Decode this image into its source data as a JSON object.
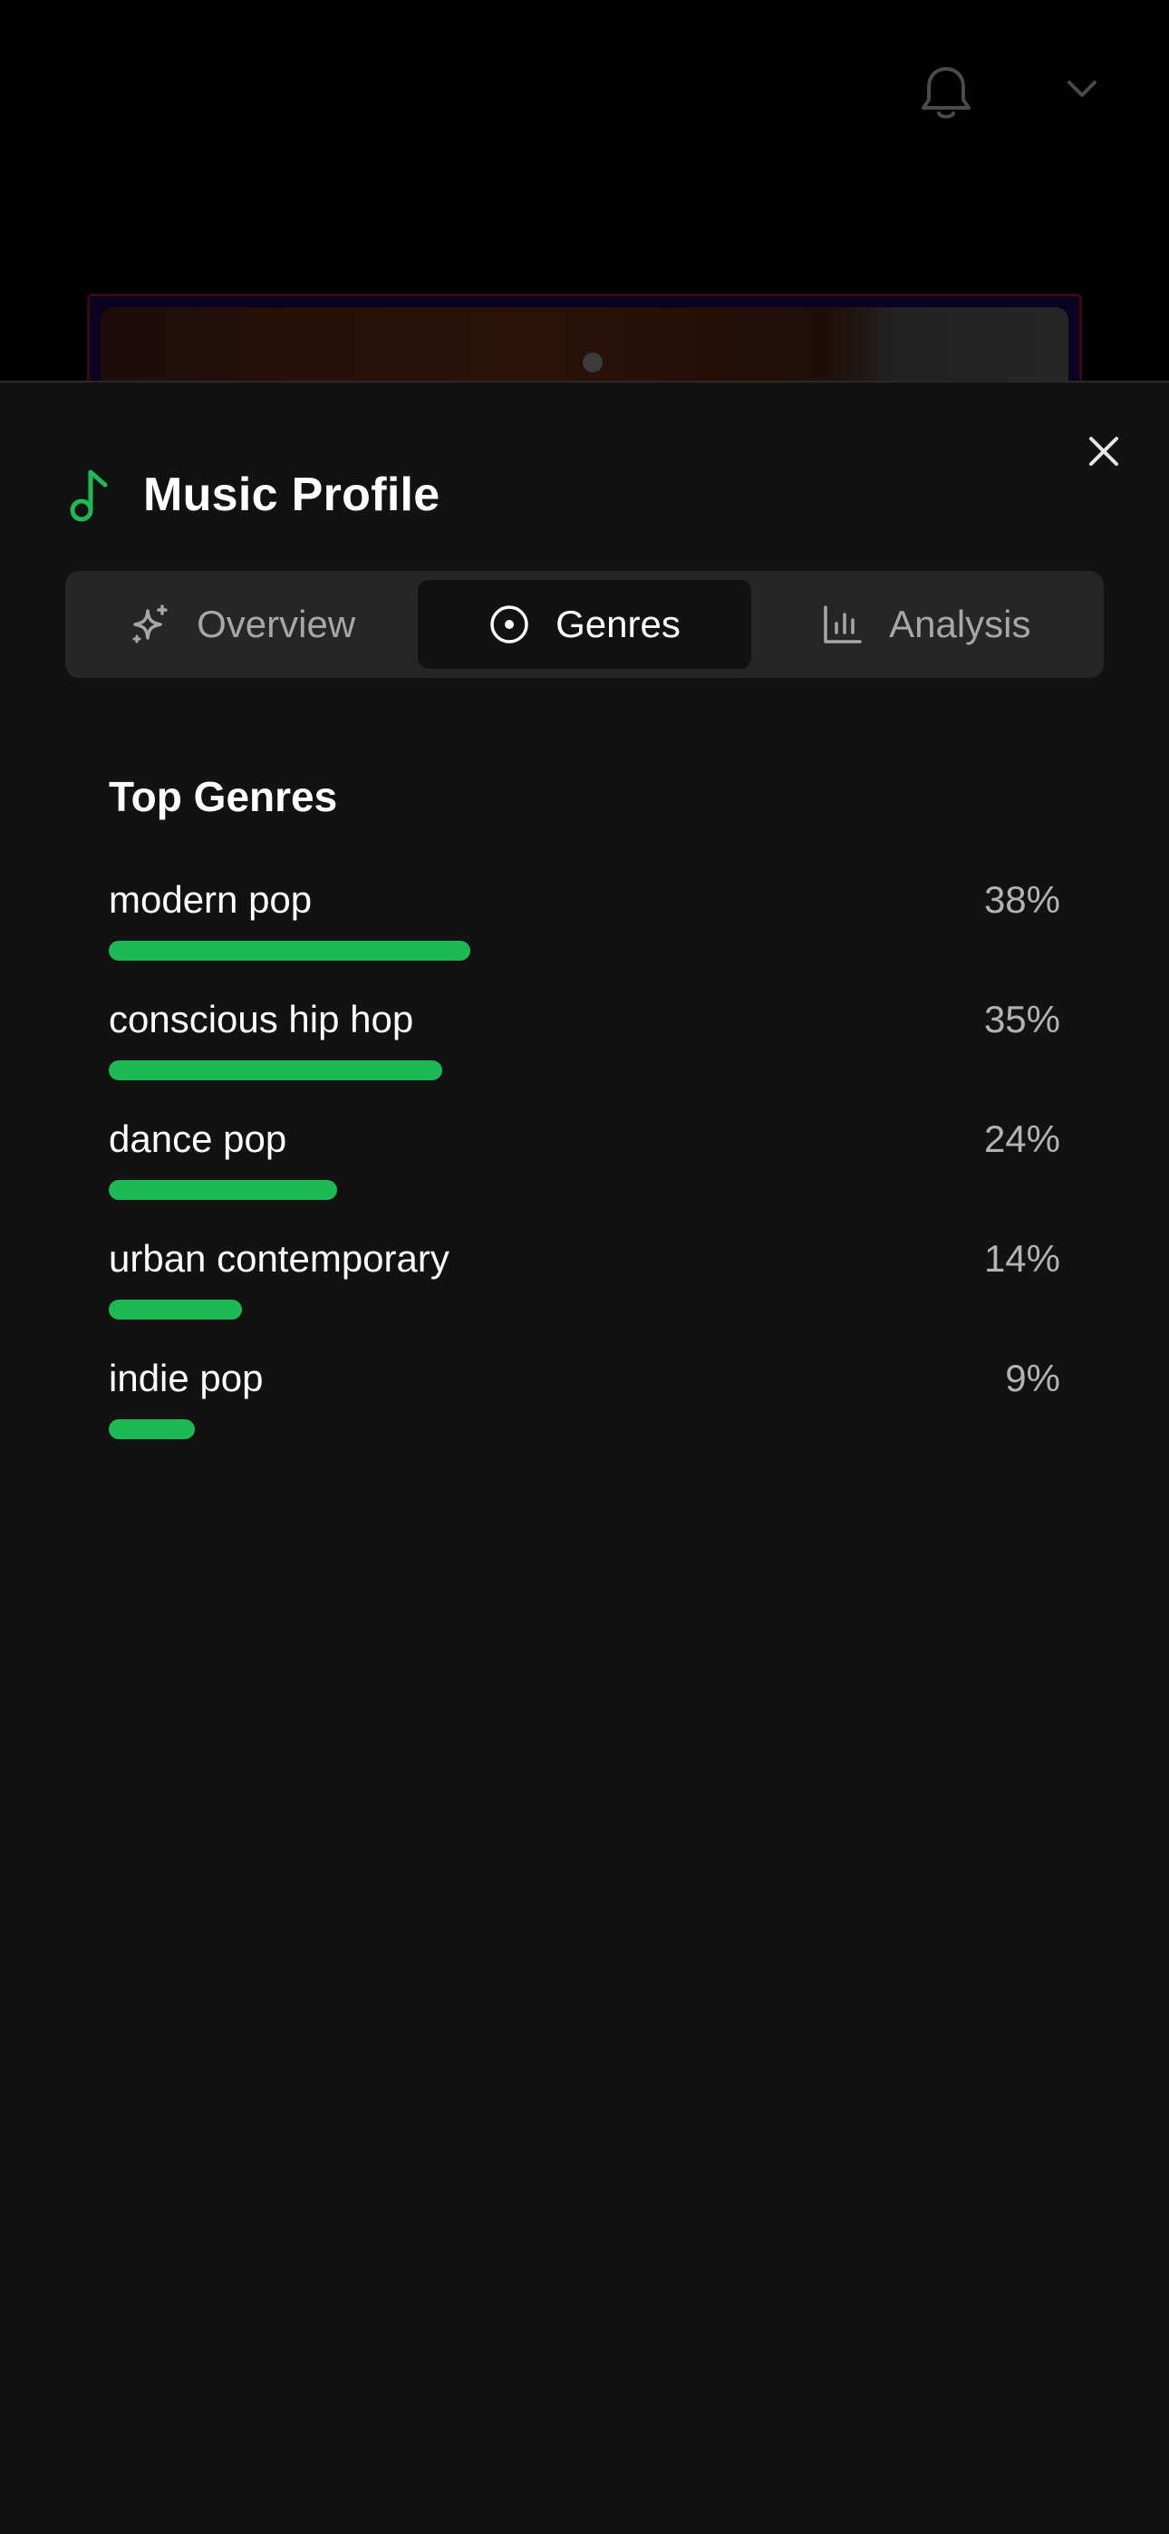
{
  "sheet": {
    "title": "Music Profile",
    "icons": {
      "header": "music-note-icon",
      "close": "close-icon"
    }
  },
  "tabs": [
    {
      "label": "Overview",
      "icon": "sparkles-icon",
      "active": false
    },
    {
      "label": "Genres",
      "icon": "disc-icon",
      "active": true
    },
    {
      "label": "Analysis",
      "icon": "bar-chart-icon",
      "active": false
    }
  ],
  "genres": {
    "title": "Top Genres",
    "items": [
      {
        "name": "modern pop",
        "percent_label": "38%",
        "percent": 38
      },
      {
        "name": "conscious hip hop",
        "percent_label": "35%",
        "percent": 35
      },
      {
        "name": "dance pop",
        "percent_label": "24%",
        "percent": 24
      },
      {
        "name": "urban contemporary",
        "percent_label": "14%",
        "percent": 14
      },
      {
        "name": "indie pop",
        "percent_label": "9%",
        "percent": 9
      }
    ]
  },
  "colors": {
    "accent": "#1db954",
    "sheet_background": "#121212",
    "tab_background": "#262626"
  }
}
